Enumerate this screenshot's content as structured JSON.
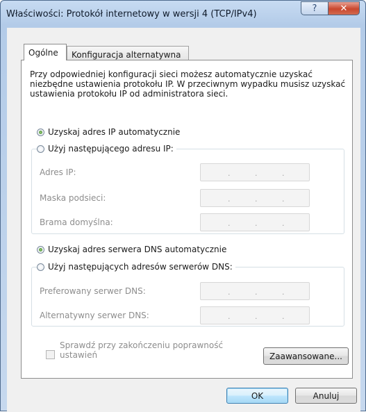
{
  "window": {
    "title": "Właściwości: Protokół internetowy w wersji 4 (TCP/IPv4)",
    "help_glyph": "?",
    "close_glyph": "✕"
  },
  "tabs": [
    {
      "label": "Ogólne",
      "active": true
    },
    {
      "label": "Konfiguracja alternatywna",
      "active": false
    }
  ],
  "intro": "Przy odpowiedniej konfiguracji sieci możesz automatycznie uzyskać niezbędne ustawienia protokołu IP. W przeciwnym wypadku musisz uzyskać ustawienia protokołu IP od administratora sieci.",
  "ip_section": {
    "auto_label": "Uzyskaj adres IP automatycznie",
    "auto_checked": true,
    "manual_label": "Użyj następującego adresu IP:",
    "manual_checked": false,
    "fields": [
      {
        "label": "Adres IP:",
        "value": ""
      },
      {
        "label": "Maska podsieci:",
        "value": ""
      },
      {
        "label": "Brama domyślna:",
        "value": ""
      }
    ]
  },
  "dns_section": {
    "auto_label": "Uzyskaj adres serwera DNS automatycznie",
    "auto_checked": true,
    "manual_label": "Użyj następujących adresów serwerów DNS:",
    "manual_checked": false,
    "fields": [
      {
        "label": "Preferowany serwer DNS:",
        "value": ""
      },
      {
        "label": "Alternatywny serwer DNS:",
        "value": ""
      }
    ]
  },
  "validate": {
    "label_line1": "Sprawdź przy zakończeniu poprawność",
    "label_line2": "ustawień",
    "checked": false
  },
  "buttons": {
    "advanced": "Zaawansowane...",
    "ok": "OK",
    "cancel": "Anuluj"
  },
  "ip_separator": "."
}
